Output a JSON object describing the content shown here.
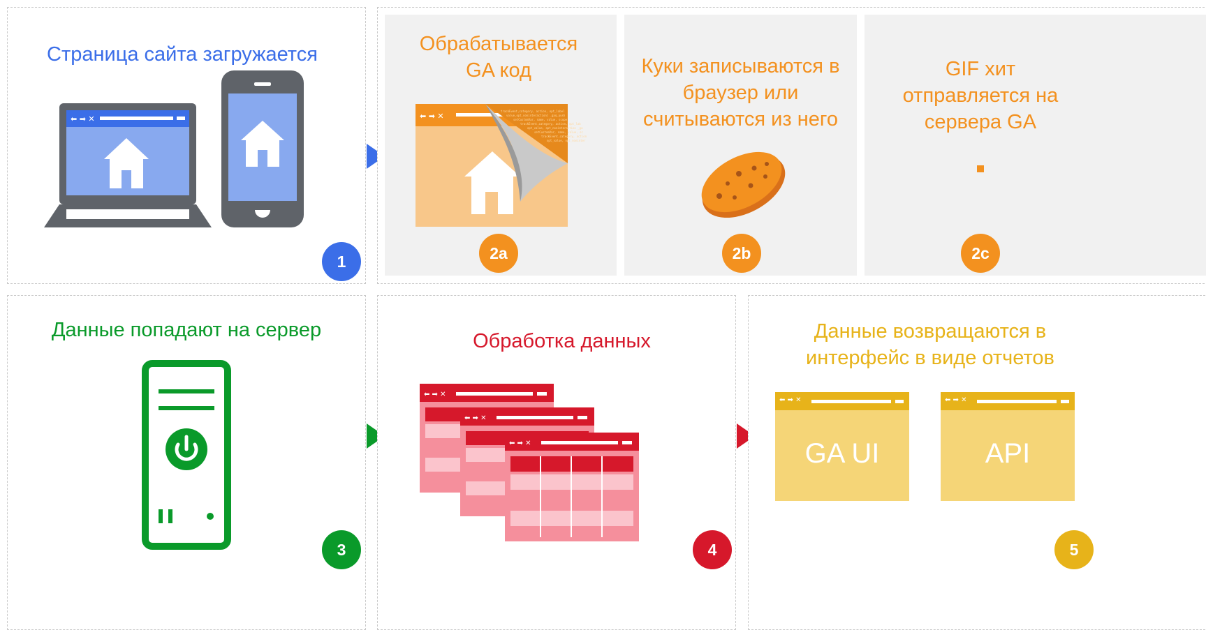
{
  "colors": {
    "blue": "#3b6ee8",
    "orange": "#f3911f",
    "green": "#0a9a2a",
    "red": "#d6182b",
    "yellow": "#e7b31a"
  },
  "step1": {
    "title": "Страница сайта загружается",
    "badge": "1",
    "icons": [
      "laptop-icon",
      "smartphone-icon",
      "home-icon"
    ]
  },
  "step2a": {
    "title_line1": "Обрабатывается",
    "title_line2": "GA код",
    "badge": "2a",
    "icons": [
      "browser-window-icon",
      "page-curl-code-icon",
      "home-icon"
    ]
  },
  "step2b": {
    "title_line1": "Куки записываются в",
    "title_line2": "браузер или",
    "title_line3": "считываются из него",
    "badge": "2b",
    "icons": [
      "cookie-icon"
    ]
  },
  "step2c": {
    "title_line1": "GIF хит",
    "title_line2": "отправляется на",
    "title_line3": "сервера GA",
    "badge": "2c",
    "icons": [
      "pixel-icon"
    ]
  },
  "step3": {
    "title": "Данные попадают на сервер",
    "badge": "3",
    "icons": [
      "server-tower-icon",
      "power-icon"
    ]
  },
  "step4": {
    "title": "Обработка данных",
    "badge": "4",
    "icons": [
      "data-tables-stack-icon"
    ]
  },
  "step5": {
    "title_line1": "Данные возвращаются в",
    "title_line2": "интерфейс в виде отчетов",
    "badge": "5",
    "window1_label": "GA UI",
    "window2_label": "API",
    "icons": [
      "report-window-icon"
    ]
  }
}
